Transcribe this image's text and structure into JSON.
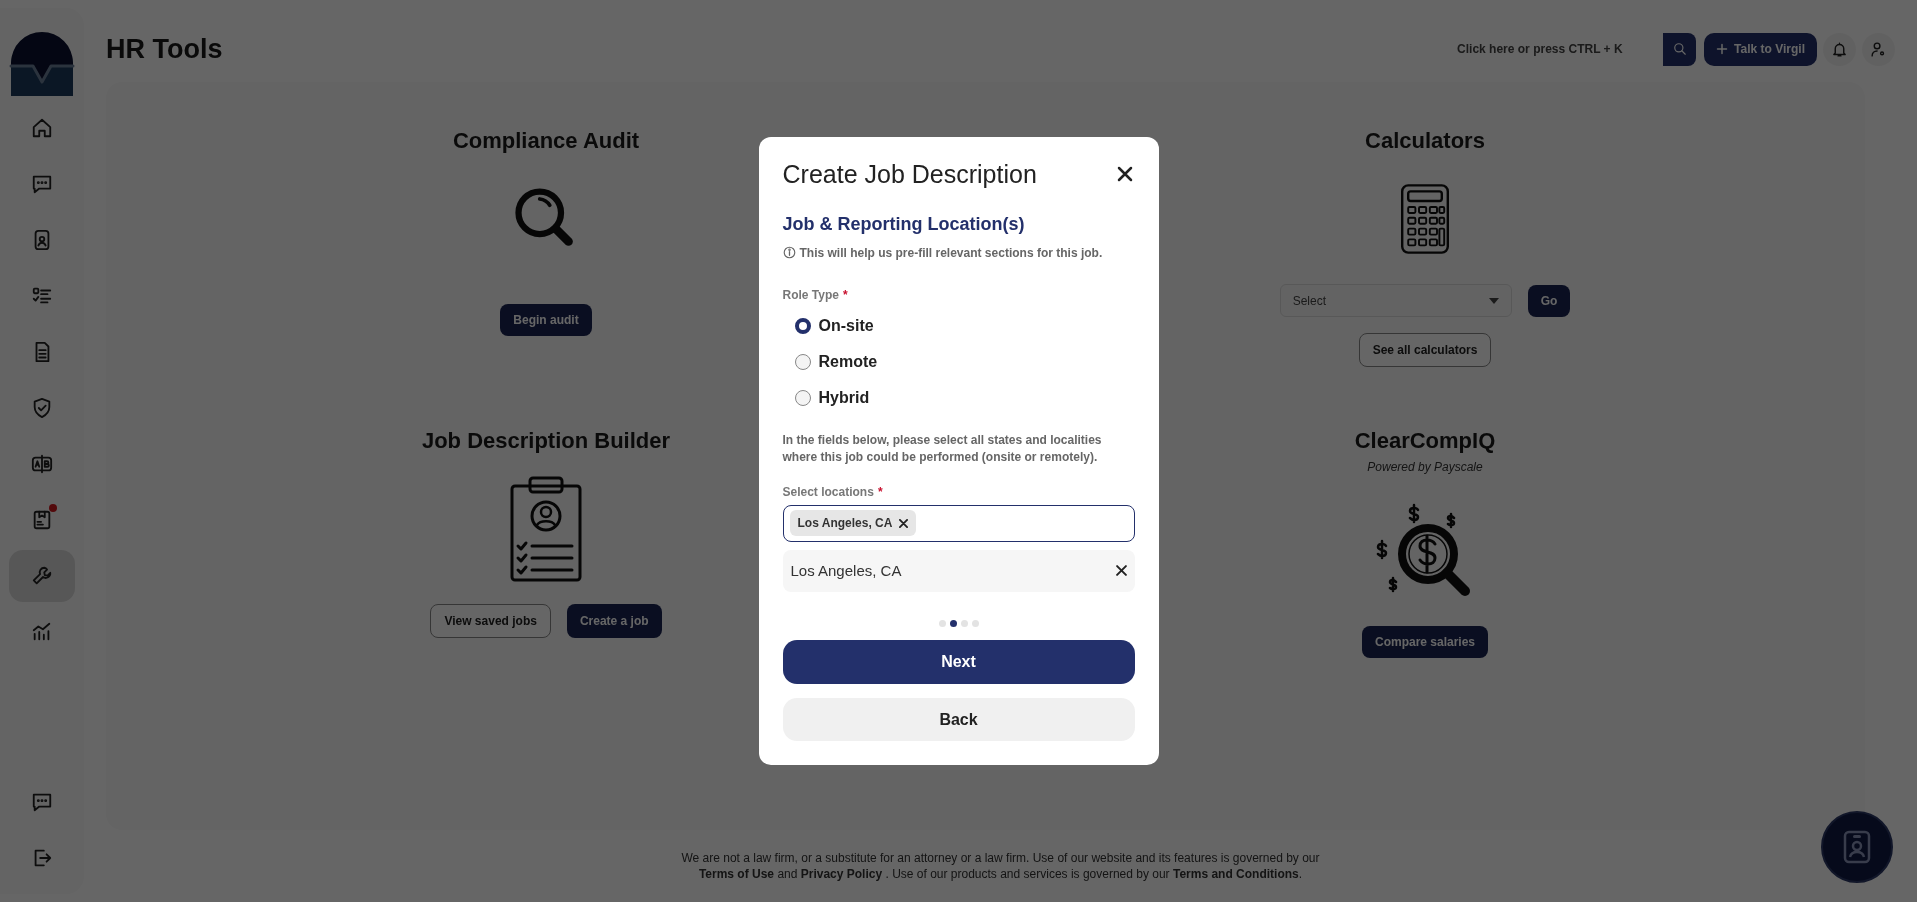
{
  "sidebar": {
    "items": [
      {
        "selected": false,
        "notification": false
      },
      {
        "selected": false,
        "notification": false
      },
      {
        "selected": false,
        "notification": false
      },
      {
        "selected": false,
        "notification": false
      },
      {
        "selected": false,
        "notification": false
      },
      {
        "selected": false,
        "notification": false
      },
      {
        "selected": false,
        "notification": false
      },
      {
        "selected": false,
        "notification": true
      },
      {
        "selected": true,
        "notification": false
      },
      {
        "selected": false,
        "notification": false
      }
    ],
    "bottom_items": [
      {
        "selected": false
      },
      {
        "selected": false
      }
    ]
  },
  "header": {
    "title": "HR Tools",
    "search": {
      "placeholder": "Click here or press CTRL + K"
    },
    "talk_button": "Talk to Virgil"
  },
  "tools": [
    {
      "title": "Compliance Audit",
      "buttons": [
        {
          "label": "Begin audit",
          "kind": "primary"
        }
      ]
    },
    {
      "title": "Calculators",
      "select": {
        "placeholder": "Select",
        "button": "Go"
      },
      "buttons": [
        {
          "label": "See all calculators",
          "kind": "outline"
        }
      ]
    },
    {
      "title": "Job Description Builder",
      "buttons": [
        {
          "label": "View saved jobs",
          "kind": "outline"
        },
        {
          "label": "Create a job",
          "kind": "primary"
        }
      ]
    },
    {
      "title": "ClearCompIQ",
      "subtitle": "Powered by Payscale",
      "buttons": [
        {
          "label": "Compare salaries",
          "kind": "primary"
        }
      ]
    }
  ],
  "modal": {
    "title": "Create Job Description",
    "section_title": "Job & Reporting Location(s)",
    "info": "This will help us pre-fill relevant sections for this job.",
    "role_type": {
      "label": "Role Type",
      "required_mark": "*",
      "options": [
        {
          "label": "On-site",
          "selected": true
        },
        {
          "label": "Remote",
          "selected": false
        },
        {
          "label": "Hybrid",
          "selected": false
        }
      ]
    },
    "instructions": "In the fields below, please select all states and localities where this job could be performed (onsite or remotely).",
    "locations": {
      "label": "Select locations",
      "required_mark": "*",
      "tags": [
        {
          "label": "Los Angeles, CA"
        }
      ],
      "selected": [
        {
          "label": "Los Angeles, CA"
        }
      ]
    },
    "steps": [
      {
        "selected": false
      },
      {
        "selected": true
      },
      {
        "selected": false
      },
      {
        "selected": false
      }
    ],
    "next_button": "Next",
    "back_button": "Back"
  },
  "footer": {
    "lines": [
      "We are not a law firm, or a substitute for an attorney or a law firm. Use of our website and its features is governed by our",
      "**Terms of Use** and **Privacy Policy** . Use of our products and services is governed by our **Terms and Conditions**."
    ]
  }
}
